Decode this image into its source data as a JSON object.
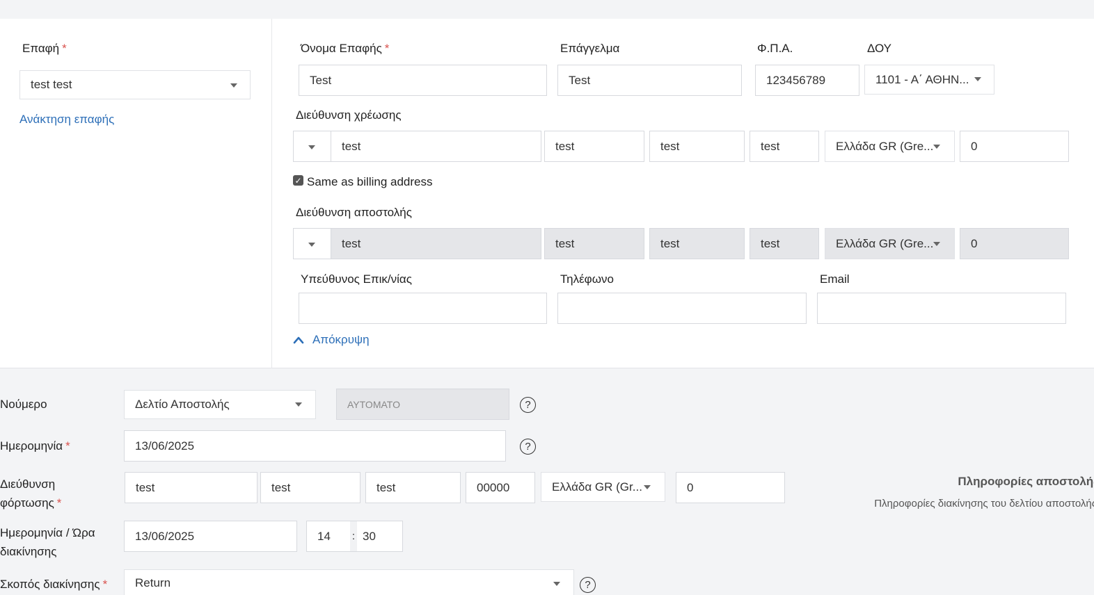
{
  "contact": {
    "label": "Επαφή",
    "required_mark": "*",
    "value": "test test",
    "retrieve_link": "Ανάκτηση επαφής"
  },
  "details": {
    "name_label": "Όνομα Επαφής",
    "name_value": "Test",
    "profession_label": "Επάγγελμα",
    "profession_value": "Test",
    "vat_label": "Φ.Π.Α.",
    "vat_value": "123456789",
    "doy_label": "ΔΟΥ",
    "doy_value": "1101 - Α΄ ΑΘΗΝ..."
  },
  "billing": {
    "label": "Διεύθυνση χρέωσης",
    "street": "test",
    "number": "test",
    "city": "test",
    "zip": "test",
    "country": "Ελλάδα GR (Gre...",
    "extra": "0"
  },
  "same_as_billing": {
    "label": "Same as billing address",
    "checked": "✓"
  },
  "shipping": {
    "label": "Διεύθυνση αποστολής",
    "street": "test",
    "number": "test",
    "city": "test",
    "zip": "test",
    "country": "Ελλάδα GR (Gre...",
    "extra": "0"
  },
  "contact_person": {
    "manager_label": "Υπεύθυνος Επικ/νίας",
    "manager_value": "",
    "phone_label": "Τηλέφωνο",
    "phone_value": "",
    "email_label": "Email",
    "email_value": ""
  },
  "hide_link": "Απόκρυψη",
  "document": {
    "number_label": "Νούμερο",
    "series_value": "Δελτίο Αποστολής",
    "auto_value": "ΑΥΤΟΜΑΤΟ",
    "date_label": "Ημερομηνία",
    "date_value": "13/06/2025",
    "loading_label_line1": "Διεύθυνση",
    "loading_label_line2": "φόρτωσης",
    "loading_street": "test",
    "loading_number": "test",
    "loading_city": "test",
    "loading_zip": "00000",
    "loading_country": "Ελλάδα GR (Gr...",
    "loading_extra": "0",
    "move_label_line1": "Ημερομηνία / Ώρα",
    "move_label_line2": "διακίνησης",
    "move_date": "13/06/2025",
    "move_hour": "14",
    "time_sep": ":",
    "move_minute": "30",
    "purpose_label": "Σκοπός διακίνησης",
    "purpose_value": "Return"
  },
  "shipping_info": {
    "title": "Πληροφορίες αποστολής",
    "subtitle": "Πληροφορίες διακίνησης του δελτίου αποστολής"
  },
  "icons": {
    "help": "?"
  }
}
